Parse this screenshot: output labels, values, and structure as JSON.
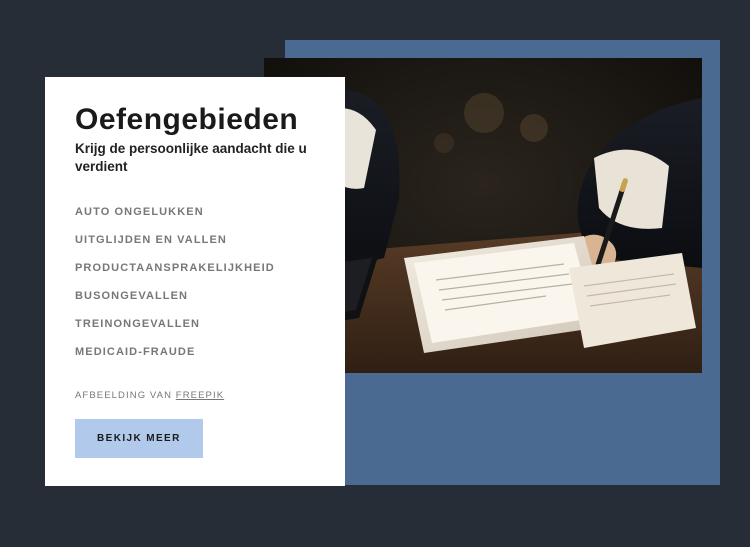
{
  "card": {
    "title": "Oefengebieden",
    "subtitle": "Krijg de persoonlijke aandacht die u verdient",
    "items": [
      "AUTO ONGELUKKEN",
      "UITGLIJDEN EN VALLEN",
      "PRODUCTAANSPRAKELIJKHEID",
      "BUSONGEVALLEN",
      "TREINONGEVALLEN",
      "MEDICAID-FRAUDE"
    ],
    "attribution_prefix": "AFBEELDING VAN ",
    "attribution_link": "FREEPIK",
    "cta_label": "BEKIJK MEER"
  }
}
